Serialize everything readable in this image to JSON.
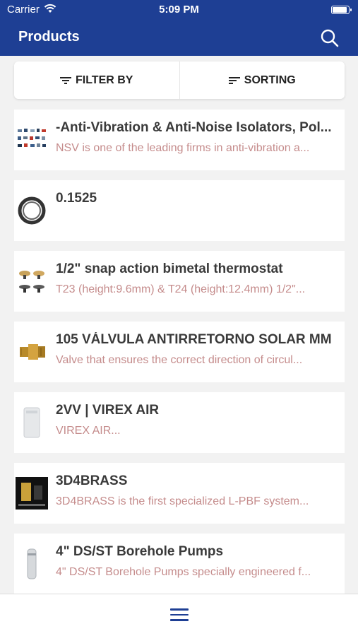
{
  "status_bar": {
    "carrier": "Carrier",
    "time": "5:09 PM"
  },
  "header": {
    "title": "Products",
    "search_icon": "search-icon"
  },
  "toolbar": {
    "filter_label": "FILTER BY",
    "sorting_label": "SORTING"
  },
  "products": [
    {
      "name": "-Anti-Vibration & Anti-Noise Isolators, Pol...",
      "description": "NSV is one of the leading firms in anti-vibration a..."
    },
    {
      "name": "0.1525",
      "description": ""
    },
    {
      "name": "1/2\" snap action bimetal thermostat",
      "description": "T23 (height:9.6mm) & T24 (height:12.4mm) 1/2\"..."
    },
    {
      "name": "105 VÁLVULA ANTIRRETORNO SOLAR MM",
      "description": "Valve that ensures the correct direction of circul..."
    },
    {
      "name": "2VV | VIREX AIR",
      "description": "VIREX AIR..."
    },
    {
      "name": "3D4BRASS",
      "description": "3D4BRASS is the first specialized L-PBF system..."
    },
    {
      "name": "4\" DS/ST Borehole Pumps",
      "description": "4\" DS/ST Borehole Pumps specially engineered f..."
    }
  ],
  "colors": {
    "brand": "#1e3f94",
    "description_text": "#c58c8c",
    "title_text": "#3a3a3a"
  }
}
